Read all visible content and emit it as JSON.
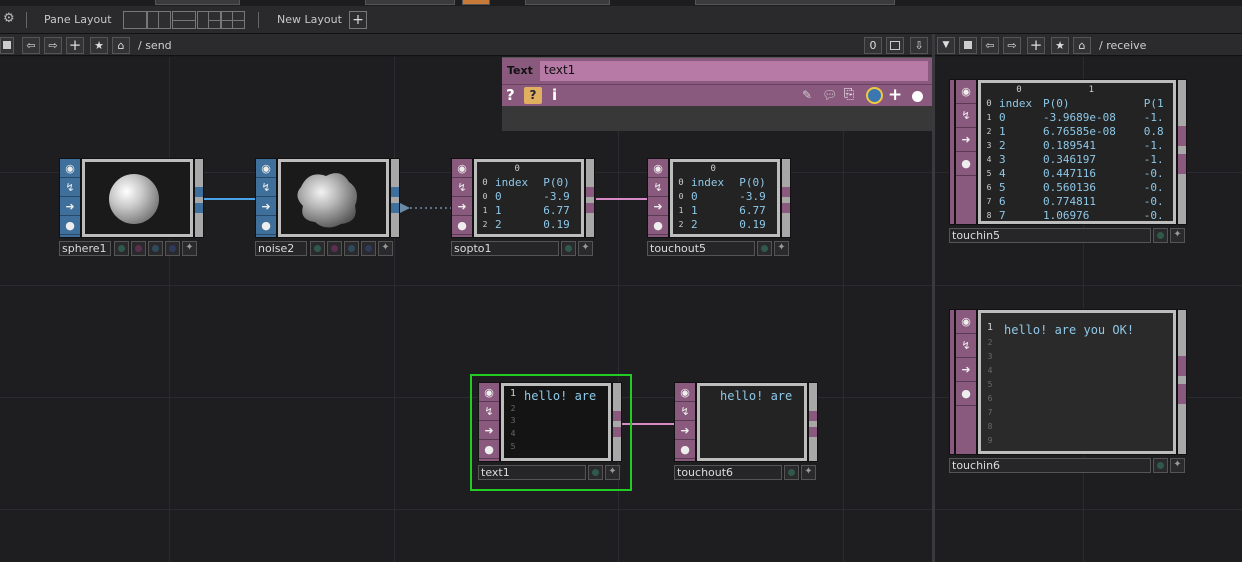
{
  "toolbar": {
    "pane_layout_label": "Pane Layout",
    "new_layout_label": "New Layout",
    "add_icon": "+"
  },
  "left_path": {
    "text": "/ send"
  },
  "right_path": {
    "text": "/ receive"
  },
  "pathbar_buttons": {
    "zero_label": "0"
  },
  "param_panel": {
    "type_label": "Text",
    "name_value": "text1",
    "help_icon": "?",
    "info_icon": "i"
  },
  "nodes": {
    "sphere1": {
      "name": "sphere1"
    },
    "noise2": {
      "name": "noise2"
    },
    "sopto1": {
      "name": "sopto1",
      "col_indices": [
        "0"
      ],
      "header": [
        "index",
        "P(0)"
      ],
      "rows": [
        [
          "0",
          "0",
          "-3.9"
        ],
        [
          "1",
          "1",
          "6.77"
        ],
        [
          "2",
          "2",
          "0.19"
        ]
      ]
    },
    "touchout5": {
      "name": "touchout5",
      "col_indices": [
        "0"
      ],
      "header": [
        "index",
        "P(0)"
      ],
      "rows": [
        [
          "0",
          "0",
          "-3.9"
        ],
        [
          "1",
          "1",
          "6.77"
        ],
        [
          "2",
          "2",
          "0.19"
        ]
      ]
    },
    "text1": {
      "name": "text1",
      "line1_num": "1",
      "text": "hello! are",
      "line_nums": [
        "2",
        "3",
        "4",
        "5"
      ]
    },
    "touchout6": {
      "name": "touchout6",
      "text": "hello! are"
    },
    "touchin5": {
      "name": "touchin5",
      "col_indices": [
        "0",
        "1"
      ],
      "header": [
        "index",
        "P(0)",
        "P(1"
      ],
      "rows": [
        [
          "1",
          "0",
          "-3.9689e-08",
          "-1."
        ],
        [
          "2",
          "1",
          "6.76585e-08",
          "0.8"
        ],
        [
          "3",
          "2",
          "0.189541",
          "-1."
        ],
        [
          "4",
          "3",
          "0.346197",
          "-1."
        ],
        [
          "5",
          "4",
          "0.447116",
          "-0."
        ],
        [
          "6",
          "5",
          "0.560136",
          "-0."
        ],
        [
          "7",
          "6",
          "0.774811",
          "-0."
        ],
        [
          "8",
          "7",
          "1.06976",
          "-0."
        ]
      ],
      "header_row_num": "0"
    },
    "touchin6": {
      "name": "touchin6",
      "line1_num": "1",
      "text": "hello! are you OK!",
      "line_nums": [
        "2",
        "3",
        "4",
        "5",
        "6",
        "7",
        "8",
        "9"
      ]
    }
  },
  "colors": {
    "sop_flag": "#3f6f9b",
    "chop_flag": "#8a5a7e",
    "link_sop": "#4aa3e6",
    "link_chop": "#d88ac8",
    "selected_outline": "#22cc22",
    "cell_text": "#8ec8e8"
  }
}
